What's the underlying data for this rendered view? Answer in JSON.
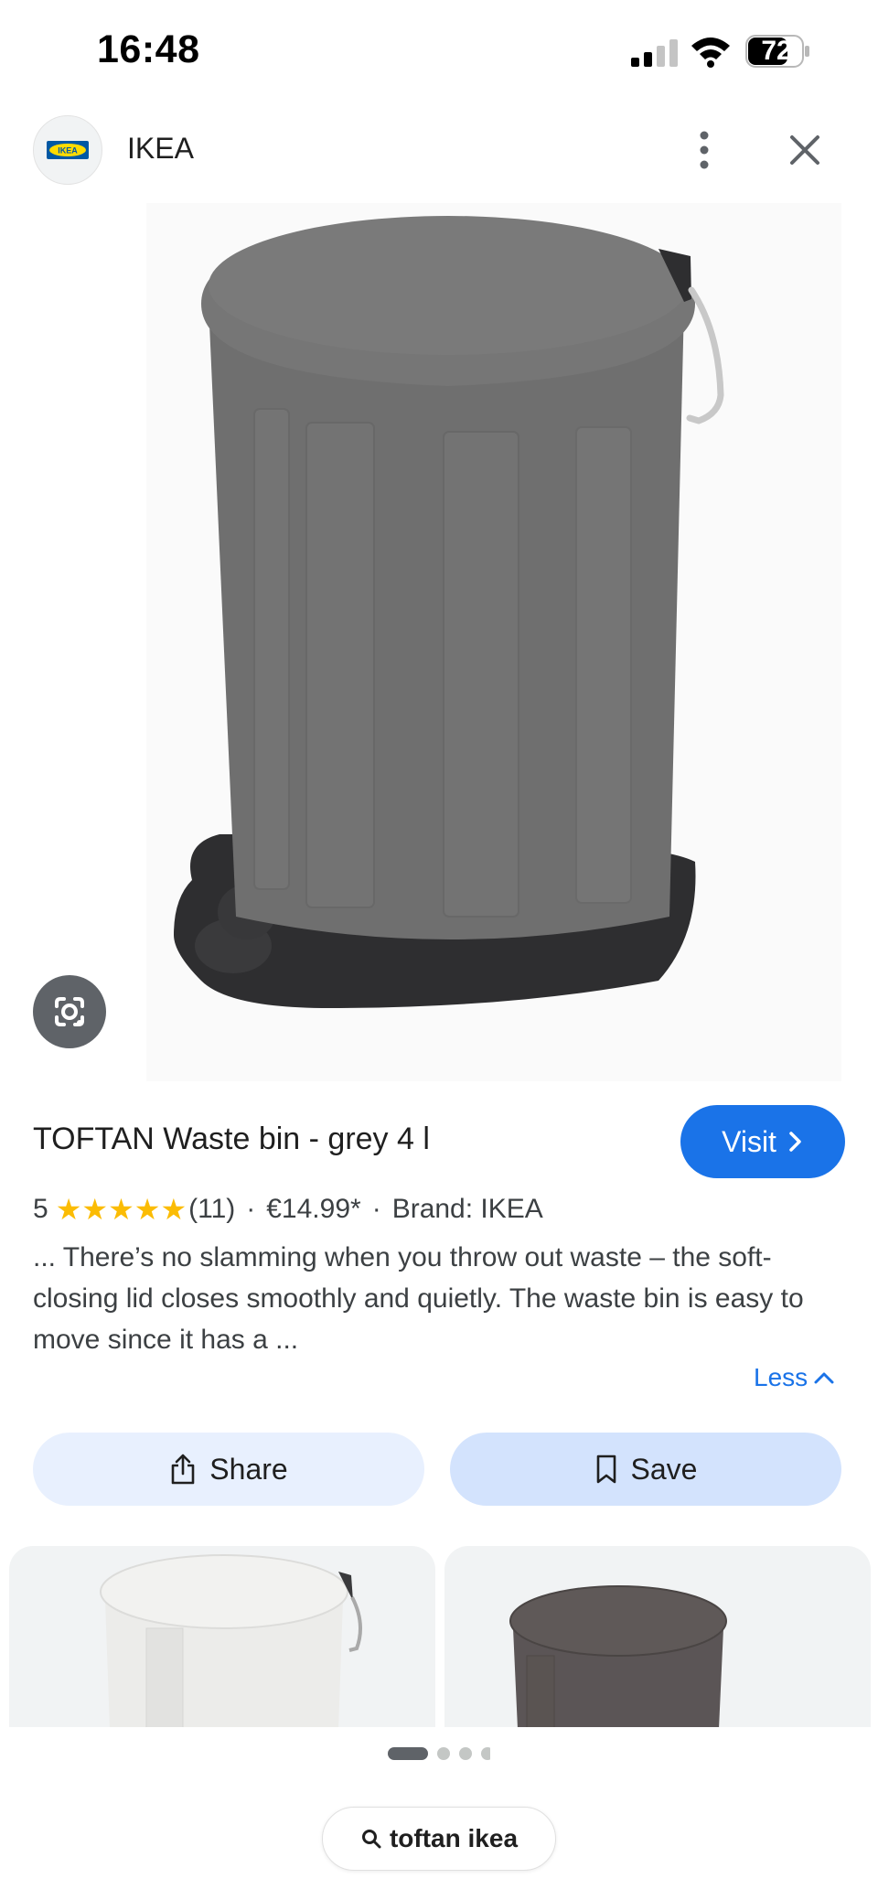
{
  "status_bar": {
    "time": "16:48",
    "battery": "72"
  },
  "header": {
    "source_name": "IKEA",
    "logo_text": "IKEA"
  },
  "product": {
    "title": "TOFTAN Waste bin - grey 4 l",
    "visit_label": "Visit",
    "rating": "5",
    "stars": 5,
    "review_count": "(11)",
    "price": "€14.99*",
    "brand": "Brand: IKEA",
    "description": "... There’s no slamming when you throw out waste – the soft-closing lid closes smoothly and quietly. The waste bin is easy to move since it has a ...",
    "less_label": "Less",
    "bin_color": "#6f6f6f",
    "base_color": "#2e2e30"
  },
  "actions": {
    "share_label": "Share",
    "save_label": "Save"
  },
  "related": [
    {
      "name": "white-waste-bin",
      "color": "#ececea"
    },
    {
      "name": "dark-grey-waste-bin",
      "color": "#5b5556"
    }
  ],
  "pager": {
    "count": 4,
    "active": 0
  },
  "search": {
    "query": "toftan ikea"
  },
  "colors": {
    "accent": "#1a73e8",
    "star": "#fbbc04",
    "share_bg": "#e8f0fe",
    "save_bg": "#d3e3fd"
  }
}
